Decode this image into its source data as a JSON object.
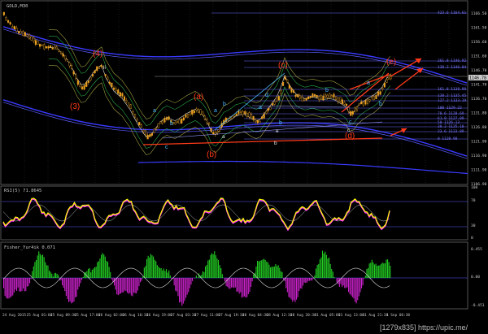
{
  "main_panel": {
    "title": "GOLD,M30",
    "price_axis": [
      "1166.50",
      "1161.50",
      "1156.60",
      "1151.60",
      "1146.70",
      "1141.70",
      "1136.70",
      "1131.80",
      "1126.80",
      "1121.90",
      "1116.90",
      "1111.90",
      "1106.90"
    ],
    "current_price": "1146.78",
    "level_labels": [
      "423.6 1164.61",
      "261.8 1146.92",
      "138.2 1146.04",
      "161.8 1138.99",
      "138.2 1135.45",
      "127.2 1133.19",
      "100 1129.22",
      "78.6 1128.69",
      "61.8 1127.09",
      "50 1126.13",
      "38.2 1125.10",
      "23.6 1123.89",
      "0 1120.98"
    ],
    "wave_labels_red": [
      "(4)",
      "(3)",
      "(a)",
      "(b)",
      "(c)",
      "(d)",
      "(e)"
    ],
    "wave_labels_blue": [
      "a",
      "b",
      "c",
      "d",
      "e"
    ],
    "wave_labels_small": [
      "ii",
      "a",
      "b",
      "e",
      "c"
    ]
  },
  "rsi_panel": {
    "title": "RSI(5) 71.8645",
    "axis": [
      "100",
      "70",
      "30",
      "0"
    ]
  },
  "fisher_panel": {
    "title": "Fisher_Yur4ik 0.071",
    "axis": [
      "0.455",
      "0.00",
      "-0.451"
    ]
  },
  "time_axis": [
    "24 Aug 2015",
    "25 Aug 01:00",
    "25 Aug 09:30",
    "25 Aug 17:00",
    "26 Aug 02:00",
    "26 Aug 10:30",
    "26 Aug 19:00",
    "27 Aug 03:30",
    "27 Aug 11:00",
    "27 Aug 19:30",
    "28 Aug 04:30",
    "28 Aug 12:30",
    "28 Aug 20:30",
    "31 Aug 05:00",
    "31 Aug 13:00",
    "31 Aug 21:30",
    "1 Sep 06:30"
  ],
  "watermark": "[1279x835] https://upic.me/",
  "colors": {
    "bg": "#000000",
    "grid": "#3a3a3a",
    "candle": "#e8a020",
    "wave_red": "#ff3a1a",
    "wave_blue": "#4ab8ff",
    "channel": "#3a3aff",
    "rsi": "#ffff00",
    "rsi_mag": "#ff33ff",
    "fisher_up": "#22cc22",
    "fisher_down": "#cc22cc",
    "text": "#c8c8c8"
  }
}
